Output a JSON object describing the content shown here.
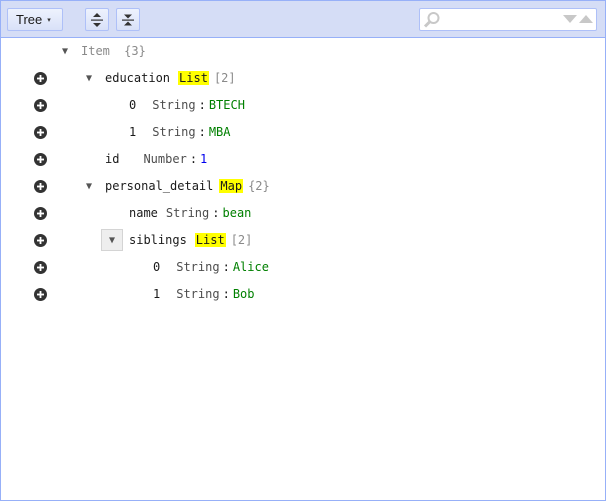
{
  "toolbar": {
    "mode_label": "Tree",
    "mode_caret": "▾",
    "expand_icon": "expand-all-icon",
    "collapse_icon": "collapse-all-icon",
    "search": {
      "placeholder": "",
      "value": ""
    }
  },
  "tree": {
    "root": {
      "label": "Item",
      "count": "{3}"
    },
    "education": {
      "field": "education",
      "type": "List",
      "count": "[2]"
    },
    "edu_0": {
      "index": "0",
      "type": "String",
      "sep": ":",
      "value": "BTECH"
    },
    "edu_1": {
      "index": "1",
      "type": "String",
      "sep": ":",
      "value": "MBA"
    },
    "id": {
      "field": "id",
      "type": "Number",
      "sep": ":",
      "value": "1"
    },
    "personal_detail": {
      "field": "personal_detail",
      "type": "Map",
      "count": "{2}"
    },
    "name": {
      "field": "name",
      "type": "String",
      "sep": ":",
      "value": "bean"
    },
    "siblings": {
      "field": "siblings",
      "type": "List",
      "count": "[2]"
    },
    "sib_0": {
      "index": "0",
      "type": "String",
      "sep": ":",
      "value": "Alice"
    },
    "sib_1": {
      "index": "1",
      "type": "String",
      "sep": ":",
      "value": "Bob"
    }
  },
  "colors": {
    "toolbar_bg": "#d5ddf6",
    "border": "#97b0f8",
    "string_value": "#008000",
    "number_value": "#0000ee",
    "type_highlight": "#ffff00"
  }
}
